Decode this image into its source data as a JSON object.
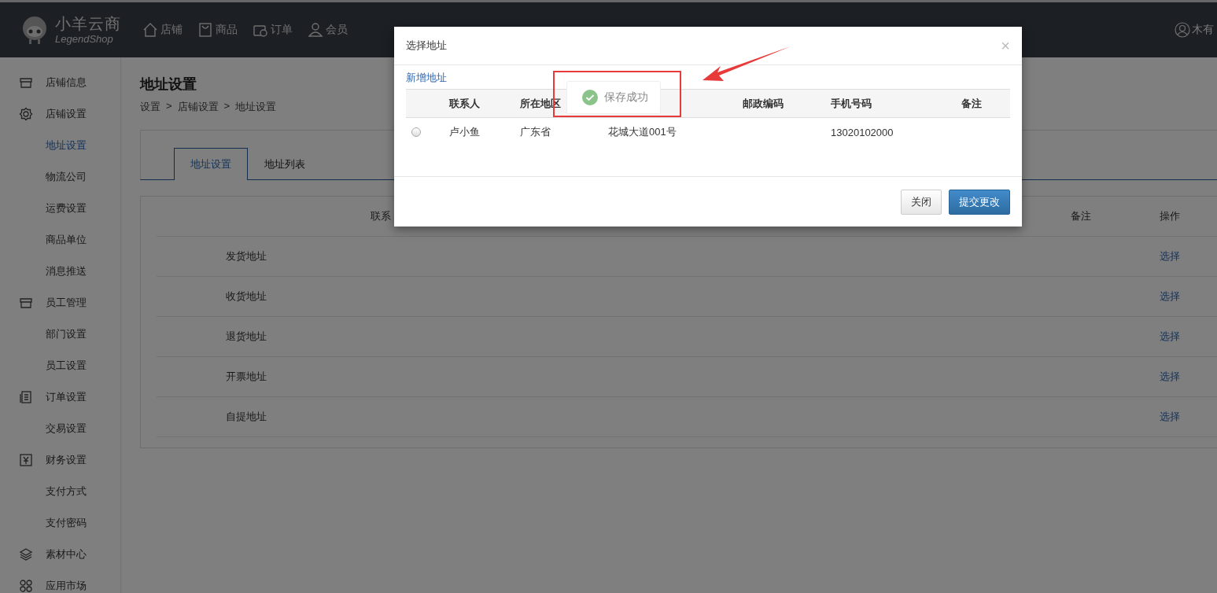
{
  "header": {
    "logo": {
      "name": "小羊云商",
      "subtitle": "LegendShop"
    },
    "nav": [
      {
        "label": "店铺"
      },
      {
        "label": "商品"
      },
      {
        "label": "订单"
      },
      {
        "label": "会员"
      }
    ],
    "user": "木有"
  },
  "sidebar": {
    "items": [
      {
        "label": "店铺信息",
        "selected": false
      },
      {
        "label": "店铺设置",
        "selected": false,
        "children": [
          {
            "label": "地址设置",
            "selected": true
          },
          {
            "label": "物流公司",
            "selected": false
          },
          {
            "label": "运费设置",
            "selected": false
          },
          {
            "label": "商品单位",
            "selected": false
          },
          {
            "label": "消息推送",
            "selected": false
          }
        ]
      },
      {
        "label": "员工管理",
        "selected": false,
        "children": [
          {
            "label": "部门设置",
            "selected": false
          },
          {
            "label": "员工设置",
            "selected": false
          }
        ]
      },
      {
        "label": "订单设置",
        "selected": false,
        "children": [
          {
            "label": "交易设置",
            "selected": false
          }
        ]
      },
      {
        "label": "财务设置",
        "selected": false,
        "children": [
          {
            "label": "支付方式",
            "selected": false
          },
          {
            "label": "支付密码",
            "selected": false
          }
        ]
      },
      {
        "label": "素材中心",
        "selected": false
      },
      {
        "label": "应用市场",
        "selected": false
      }
    ]
  },
  "page": {
    "title": "地址设置",
    "breadcrumb": [
      "设置",
      "店铺设置",
      "地址设置"
    ],
    "separator": ">"
  },
  "tabs": [
    {
      "label": "地址设置",
      "selected": true
    },
    {
      "label": "地址列表",
      "selected": false
    }
  ],
  "address_table": {
    "columns": [
      "联系",
      "备注",
      "操作"
    ],
    "rows": [
      {
        "type": "发货地址",
        "action": "选择"
      },
      {
        "type": "收货地址",
        "action": "选择"
      },
      {
        "type": "退货地址",
        "action": "选择"
      },
      {
        "type": "开票地址",
        "action": "选择"
      },
      {
        "type": "自提地址",
        "action": "选择"
      }
    ]
  },
  "dialog": {
    "title": "选择地址",
    "close": "×",
    "add_link": "新增地址",
    "columns": [
      "联系人",
      "所在地区",
      "邮政编码",
      "手机号码",
      "备注"
    ],
    "rows": [
      {
        "selected": false,
        "contact": "卢小鱼",
        "region": "广东省",
        "street": "花城大道001号",
        "phone": "13020102000"
      }
    ],
    "buttons": [
      {
        "label": "关闭",
        "kind": "default"
      },
      {
        "label": "提交更改",
        "kind": "primary"
      }
    ]
  },
  "toast": {
    "message": "保存成功"
  },
  "annotations": {
    "highlight_box": {
      "color": "#e83a3a"
    },
    "arrow": {
      "color": "#e83a3a"
    }
  }
}
